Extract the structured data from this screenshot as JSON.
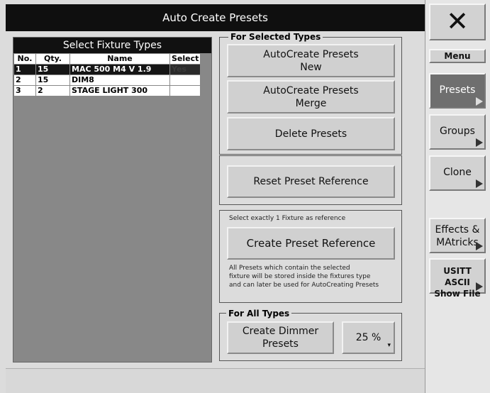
{
  "window": {
    "title": "Auto Create Presets"
  },
  "fixture_panel": {
    "title": "Select Fixture Types",
    "columns": [
      "No.",
      "Qty.",
      "Name",
      "Select"
    ],
    "rows": [
      {
        "no": "1",
        "qty": "15",
        "name": "MAC 500 M4 V 1.9",
        "select": "Yes"
      },
      {
        "no": "2",
        "qty": "15",
        "name": "DIM8",
        "select": ""
      },
      {
        "no": "3",
        "qty": "2",
        "name": "STAGE LIGHT 300",
        "select": ""
      }
    ],
    "selected_row": 1
  },
  "selected_types": {
    "label": "For Selected Types",
    "autocreate_new_line1": "AutoCreate Presets",
    "autocreate_new_line2": "New",
    "autocreate_merge_line1": "AutoCreate Presets",
    "autocreate_merge_line2": "Merge",
    "delete_label": "Delete Presets"
  },
  "reset_reference_label": "Reset Preset Reference",
  "reference_box": {
    "hint": "Select exactly 1 Fixture as reference",
    "create_label": "Create Preset Reference",
    "note_line1": "All Presets which contain the selected",
    "note_line2": "fixture will be stored inside the fixtures type",
    "note_line3": "and can later be used for AutoCreating Presets"
  },
  "all_types": {
    "label": "For All Types",
    "dimmer_line1": "Create Dimmer",
    "dimmer_line2": "Presets",
    "percent_value": "25 %"
  },
  "sidebar": {
    "close_symbol": "✕",
    "menu_label": "Menu",
    "presets_label": "Presets",
    "groups_label": "Groups",
    "clone_label": "Clone",
    "effects_line1": "Effects &",
    "effects_line2": "MAtricks",
    "usitt_line1": "USITT ASCII",
    "usitt_line2": "Show File"
  },
  "colors": {
    "title_bg": "#0f0f0f",
    "panel_gray": "#888888",
    "active_sidebar": "#6f6f6f"
  }
}
